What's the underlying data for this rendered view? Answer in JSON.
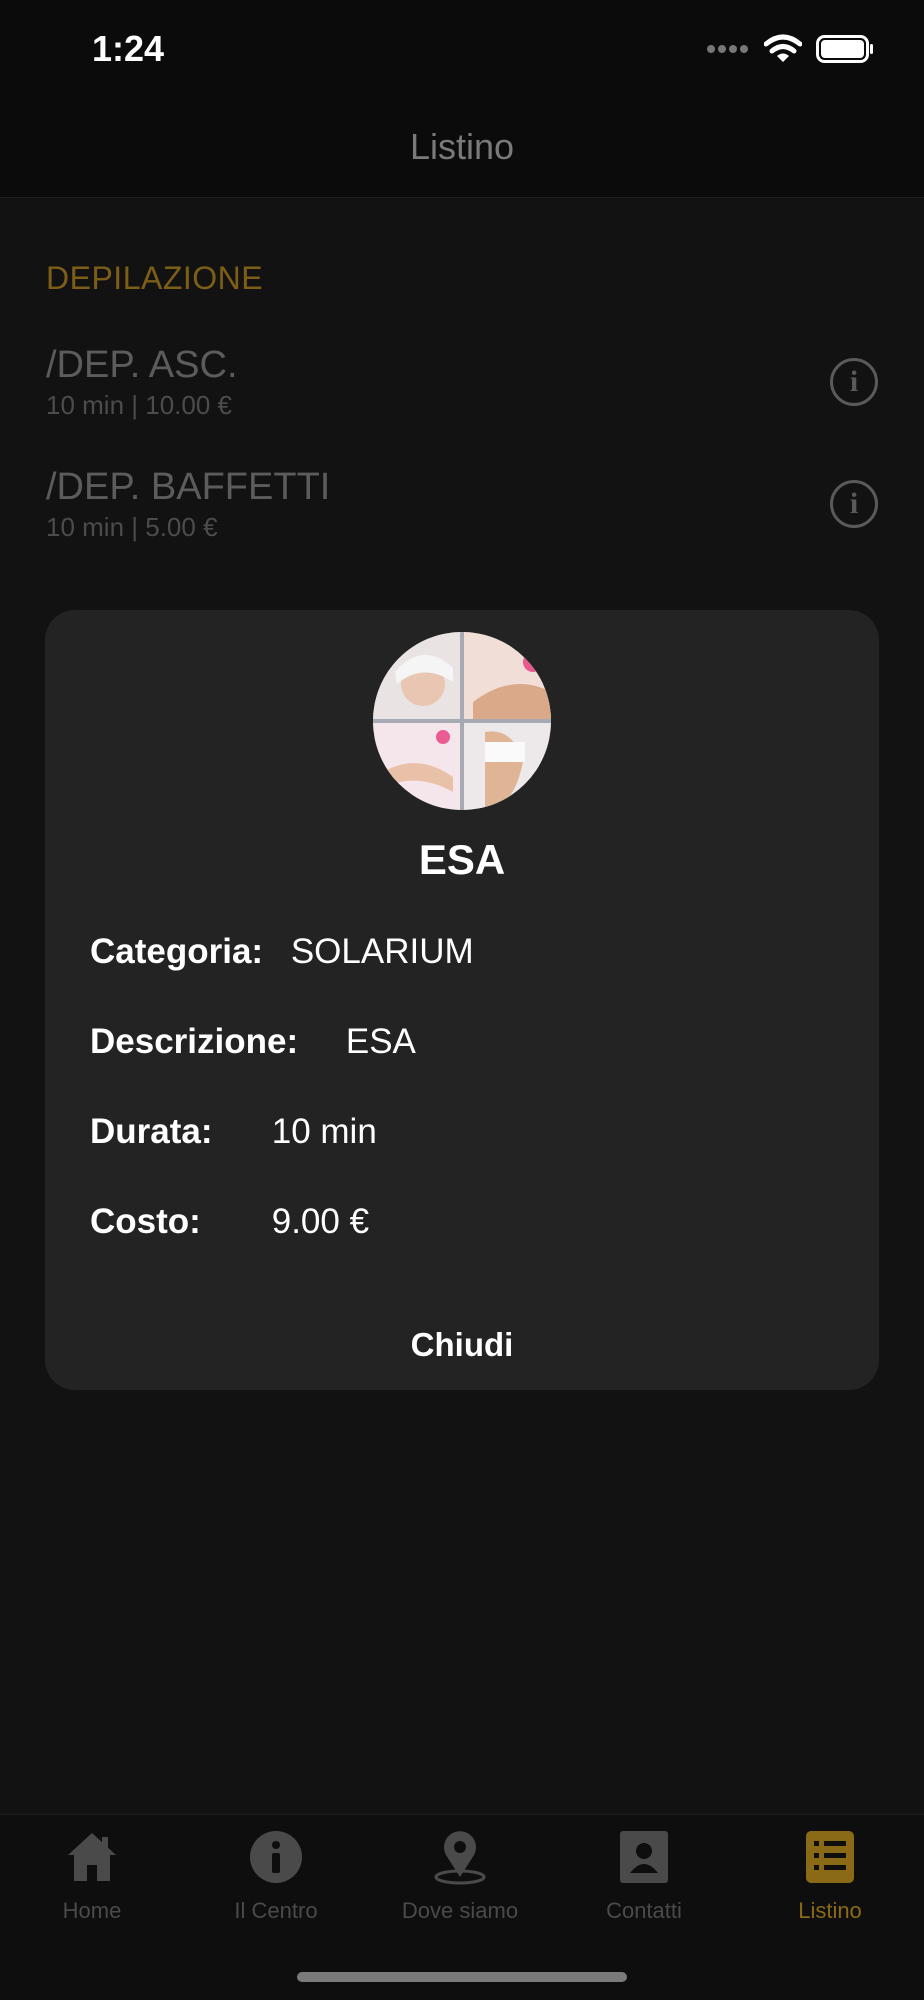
{
  "status": {
    "time": "1:24"
  },
  "nav": {
    "title": "Listino"
  },
  "section": {
    "title": "DEPILAZIONE"
  },
  "items": [
    {
      "title": "/DEP. ASC.",
      "sub": "10 min | 10.00 €"
    },
    {
      "title": "/DEP. BAFFETTI",
      "sub": "10 min | 5.00 €"
    }
  ],
  "modal": {
    "title": "ESA",
    "category_label": "Categoria:",
    "category_value": "SOLARIUM",
    "description_label": "Descrizione:",
    "description_value": "ESA",
    "duration_label": "Durata:",
    "duration_value": "10 min",
    "cost_label": "Costo:",
    "cost_value": "9.00 €",
    "close_label": "Chiudi"
  },
  "tabs": [
    {
      "label": "Home",
      "icon": "home-icon"
    },
    {
      "label": "Il Centro",
      "icon": "info-icon"
    },
    {
      "label": "Dove siamo",
      "icon": "map-pin-icon"
    },
    {
      "label": "Contatti",
      "icon": "contact-icon"
    },
    {
      "label": "Listino",
      "icon": "list-icon"
    }
  ],
  "colors": {
    "accent": "#8a6a16",
    "section": "#7d5e17",
    "modal_bg": "#232323"
  }
}
